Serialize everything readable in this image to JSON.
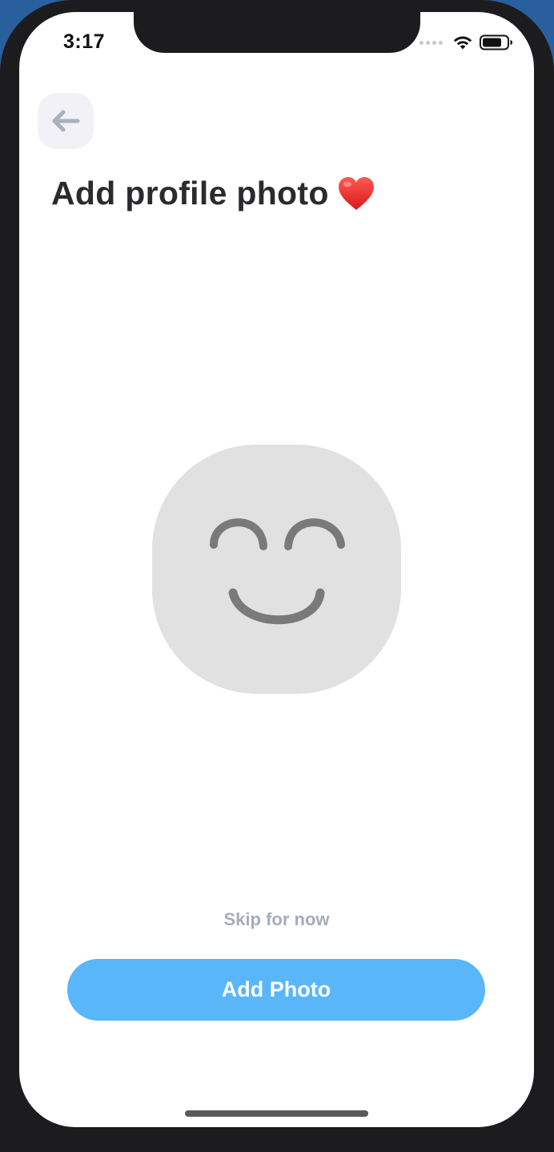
{
  "status_bar": {
    "time": "3:17",
    "wifi_icon": "wifi-icon",
    "battery_icon": "battery-icon",
    "signal_icon": "cellular-signal-icon"
  },
  "header": {
    "back_icon": "arrow-left-icon",
    "title": "Add profile photo",
    "title_emoji": "❤️"
  },
  "avatar": {
    "icon": "smiley-face-icon"
  },
  "actions": {
    "skip_label": "Skip for now",
    "add_photo_label": "Add Photo"
  },
  "colors": {
    "primary_button": "#59b6f9",
    "skip_text": "#a5adbc",
    "title_text": "#2b2b2d",
    "avatar_background": "#e1e1e2",
    "avatar_face": "#7a7a7a",
    "back_button_background": "#f1f1f6",
    "back_arrow": "#a8b0bf"
  }
}
